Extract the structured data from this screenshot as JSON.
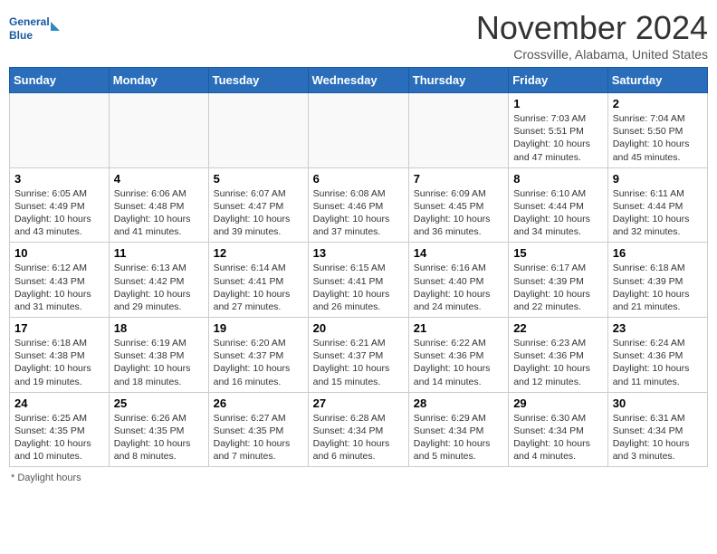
{
  "header": {
    "logo_text_general": "General",
    "logo_text_blue": "Blue",
    "month_title": "November 2024",
    "location": "Crossville, Alabama, United States"
  },
  "days_of_week": [
    "Sunday",
    "Monday",
    "Tuesday",
    "Wednesday",
    "Thursday",
    "Friday",
    "Saturday"
  ],
  "weeks": [
    [
      {
        "date": "",
        "info": ""
      },
      {
        "date": "",
        "info": ""
      },
      {
        "date": "",
        "info": ""
      },
      {
        "date": "",
        "info": ""
      },
      {
        "date": "",
        "info": ""
      },
      {
        "date": "1",
        "info": "Sunrise: 7:03 AM\nSunset: 5:51 PM\nDaylight: 10 hours and 47 minutes."
      },
      {
        "date": "2",
        "info": "Sunrise: 7:04 AM\nSunset: 5:50 PM\nDaylight: 10 hours and 45 minutes."
      }
    ],
    [
      {
        "date": "3",
        "info": "Sunrise: 6:05 AM\nSunset: 4:49 PM\nDaylight: 10 hours and 43 minutes."
      },
      {
        "date": "4",
        "info": "Sunrise: 6:06 AM\nSunset: 4:48 PM\nDaylight: 10 hours and 41 minutes."
      },
      {
        "date": "5",
        "info": "Sunrise: 6:07 AM\nSunset: 4:47 PM\nDaylight: 10 hours and 39 minutes."
      },
      {
        "date": "6",
        "info": "Sunrise: 6:08 AM\nSunset: 4:46 PM\nDaylight: 10 hours and 37 minutes."
      },
      {
        "date": "7",
        "info": "Sunrise: 6:09 AM\nSunset: 4:45 PM\nDaylight: 10 hours and 36 minutes."
      },
      {
        "date": "8",
        "info": "Sunrise: 6:10 AM\nSunset: 4:44 PM\nDaylight: 10 hours and 34 minutes."
      },
      {
        "date": "9",
        "info": "Sunrise: 6:11 AM\nSunset: 4:44 PM\nDaylight: 10 hours and 32 minutes."
      }
    ],
    [
      {
        "date": "10",
        "info": "Sunrise: 6:12 AM\nSunset: 4:43 PM\nDaylight: 10 hours and 31 minutes."
      },
      {
        "date": "11",
        "info": "Sunrise: 6:13 AM\nSunset: 4:42 PM\nDaylight: 10 hours and 29 minutes."
      },
      {
        "date": "12",
        "info": "Sunrise: 6:14 AM\nSunset: 4:41 PM\nDaylight: 10 hours and 27 minutes."
      },
      {
        "date": "13",
        "info": "Sunrise: 6:15 AM\nSunset: 4:41 PM\nDaylight: 10 hours and 26 minutes."
      },
      {
        "date": "14",
        "info": "Sunrise: 6:16 AM\nSunset: 4:40 PM\nDaylight: 10 hours and 24 minutes."
      },
      {
        "date": "15",
        "info": "Sunrise: 6:17 AM\nSunset: 4:39 PM\nDaylight: 10 hours and 22 minutes."
      },
      {
        "date": "16",
        "info": "Sunrise: 6:18 AM\nSunset: 4:39 PM\nDaylight: 10 hours and 21 minutes."
      }
    ],
    [
      {
        "date": "17",
        "info": "Sunrise: 6:18 AM\nSunset: 4:38 PM\nDaylight: 10 hours and 19 minutes."
      },
      {
        "date": "18",
        "info": "Sunrise: 6:19 AM\nSunset: 4:38 PM\nDaylight: 10 hours and 18 minutes."
      },
      {
        "date": "19",
        "info": "Sunrise: 6:20 AM\nSunset: 4:37 PM\nDaylight: 10 hours and 16 minutes."
      },
      {
        "date": "20",
        "info": "Sunrise: 6:21 AM\nSunset: 4:37 PM\nDaylight: 10 hours and 15 minutes."
      },
      {
        "date": "21",
        "info": "Sunrise: 6:22 AM\nSunset: 4:36 PM\nDaylight: 10 hours and 14 minutes."
      },
      {
        "date": "22",
        "info": "Sunrise: 6:23 AM\nSunset: 4:36 PM\nDaylight: 10 hours and 12 minutes."
      },
      {
        "date": "23",
        "info": "Sunrise: 6:24 AM\nSunset: 4:36 PM\nDaylight: 10 hours and 11 minutes."
      }
    ],
    [
      {
        "date": "24",
        "info": "Sunrise: 6:25 AM\nSunset: 4:35 PM\nDaylight: 10 hours and 10 minutes."
      },
      {
        "date": "25",
        "info": "Sunrise: 6:26 AM\nSunset: 4:35 PM\nDaylight: 10 hours and 8 minutes."
      },
      {
        "date": "26",
        "info": "Sunrise: 6:27 AM\nSunset: 4:35 PM\nDaylight: 10 hours and 7 minutes."
      },
      {
        "date": "27",
        "info": "Sunrise: 6:28 AM\nSunset: 4:34 PM\nDaylight: 10 hours and 6 minutes."
      },
      {
        "date": "28",
        "info": "Sunrise: 6:29 AM\nSunset: 4:34 PM\nDaylight: 10 hours and 5 minutes."
      },
      {
        "date": "29",
        "info": "Sunrise: 6:30 AM\nSunset: 4:34 PM\nDaylight: 10 hours and 4 minutes."
      },
      {
        "date": "30",
        "info": "Sunrise: 6:31 AM\nSunset: 4:34 PM\nDaylight: 10 hours and 3 minutes."
      }
    ]
  ],
  "footer": {
    "daylight_label": "Daylight hours"
  }
}
